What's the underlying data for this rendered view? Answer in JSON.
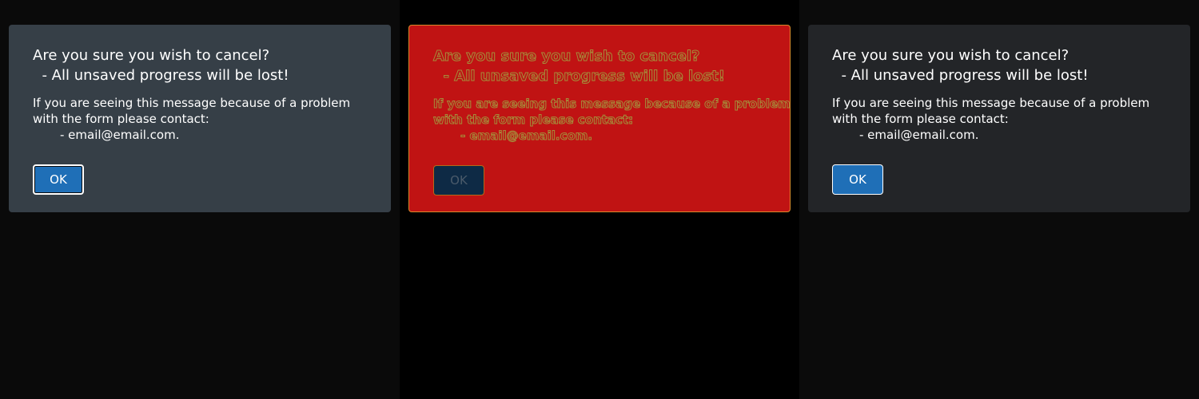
{
  "dialogs": [
    {
      "title_line1": "Are you sure you wish to cancel?",
      "title_line2": "  - All unsaved progress will be lost!",
      "body_line1": "If you are seeing this message because of a problem",
      "body_line2": "with the form please contact:",
      "email_line": "- email@email.com.",
      "ok_label": "OK",
      "background": "#363f47"
    },
    {
      "title_line1": "Are you sure you wish to cancel?",
      "title_line2": "  - All unsaved progress will be lost!",
      "body_line1": "If you are seeing this message because of a problem",
      "body_line2": "with the form please contact:",
      "email_line": "- email@email.com.",
      "ok_label": "OK",
      "background": "#c01313"
    },
    {
      "title_line1": "Are you sure you wish to cancel?",
      "title_line2": "  - All unsaved progress will be lost!",
      "body_line1": "If you are seeing this message because of a problem",
      "body_line2": "with the form please contact:",
      "email_line": "- email@email.com.",
      "ok_label": "OK",
      "background": "#232528"
    }
  ],
  "colors": {
    "button_blue": "#1f6fb7",
    "text_white": "#ffffff"
  }
}
